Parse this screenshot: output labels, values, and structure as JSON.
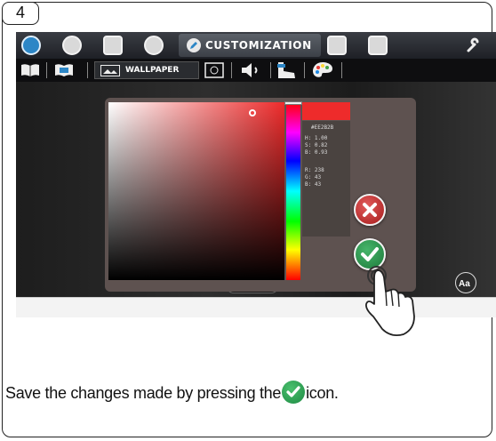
{
  "step": {
    "number": "4"
  },
  "topbar": {
    "active_label": "CUSTOMIZATION"
  },
  "subbar": {
    "active_label": "WALLPAPER"
  },
  "color_picker": {
    "hex": "#EE2B2B",
    "hsb": {
      "h_label": "H:",
      "h": "1.00",
      "s_label": "S:",
      "s": "0.82",
      "b_label": "B:",
      "b": "0.93"
    },
    "rgb": {
      "r_label": "R:",
      "r": "238",
      "g_label": "G:",
      "g": "43",
      "b_label": "B:",
      "b": "43"
    },
    "selected_color": "#ee2b2b"
  },
  "caption": {
    "before_icon": "Save the changes made by pressing the",
    "after_icon": "icon."
  },
  "colors": {
    "ok_green": "#1f8a44",
    "cancel_red": "#b32222",
    "panel_bg": "#5e5250"
  },
  "icons": [
    "droplet-icon",
    "clock-icon",
    "card-icon",
    "info-icon",
    "pencil-icon",
    "screen-icon",
    "user-icon",
    "wrench-icon",
    "book-icon",
    "image-icon",
    "speaker-icon",
    "palette-icon",
    "close-icon",
    "check-icon",
    "font-icon",
    "pointing-hand-icon"
  ]
}
